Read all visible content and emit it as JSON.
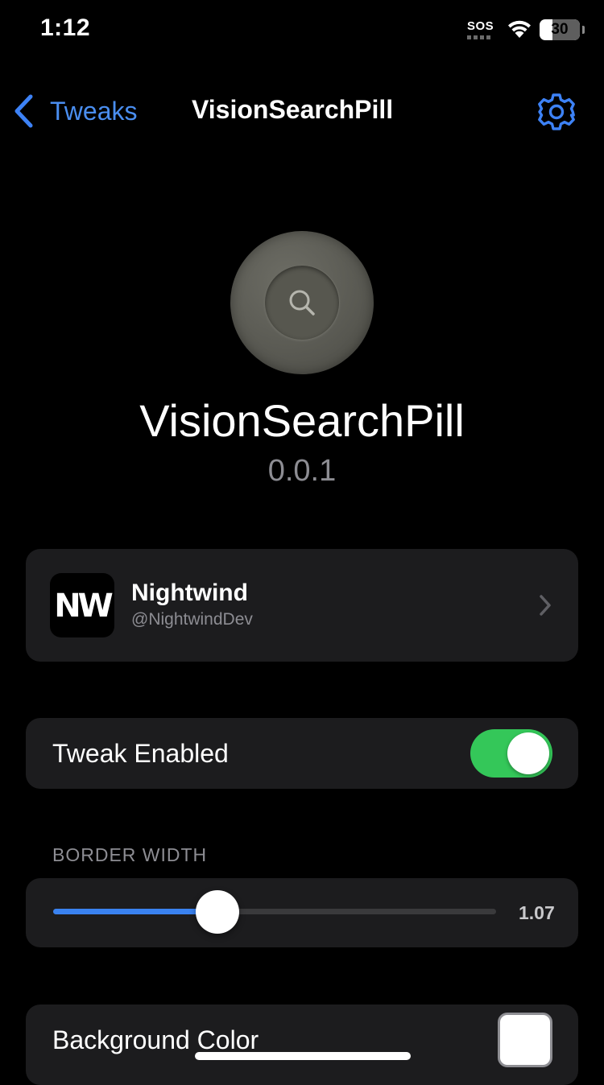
{
  "status_bar": {
    "time": "1:12",
    "carrier": "SOS",
    "battery": "30"
  },
  "nav": {
    "back_label": "Tweaks",
    "title": "VisionSearchPill",
    "back_icon": "chevron-left-icon",
    "settings_icon": "gear-icon"
  },
  "header": {
    "icon": "magnifying-glass-icon",
    "name": "VisionSearchPill",
    "version": "0.0.1"
  },
  "developer": {
    "avatar_text": "NW",
    "name": "Nightwind",
    "handle": "@NightwindDev"
  },
  "settings": {
    "tweak_enabled": {
      "label": "Tweak Enabled",
      "value": true
    },
    "border_width": {
      "section_title": "BORDER WIDTH",
      "value_display": "1.07",
      "fraction": 0.37
    },
    "background_color": {
      "label": "Background Color",
      "value": "#ffffff"
    }
  },
  "colors": {
    "accent": "#3d82f6",
    "toggle_on": "#34c759",
    "card": "#1c1c1e",
    "secondary_text": "#8d8d93"
  }
}
